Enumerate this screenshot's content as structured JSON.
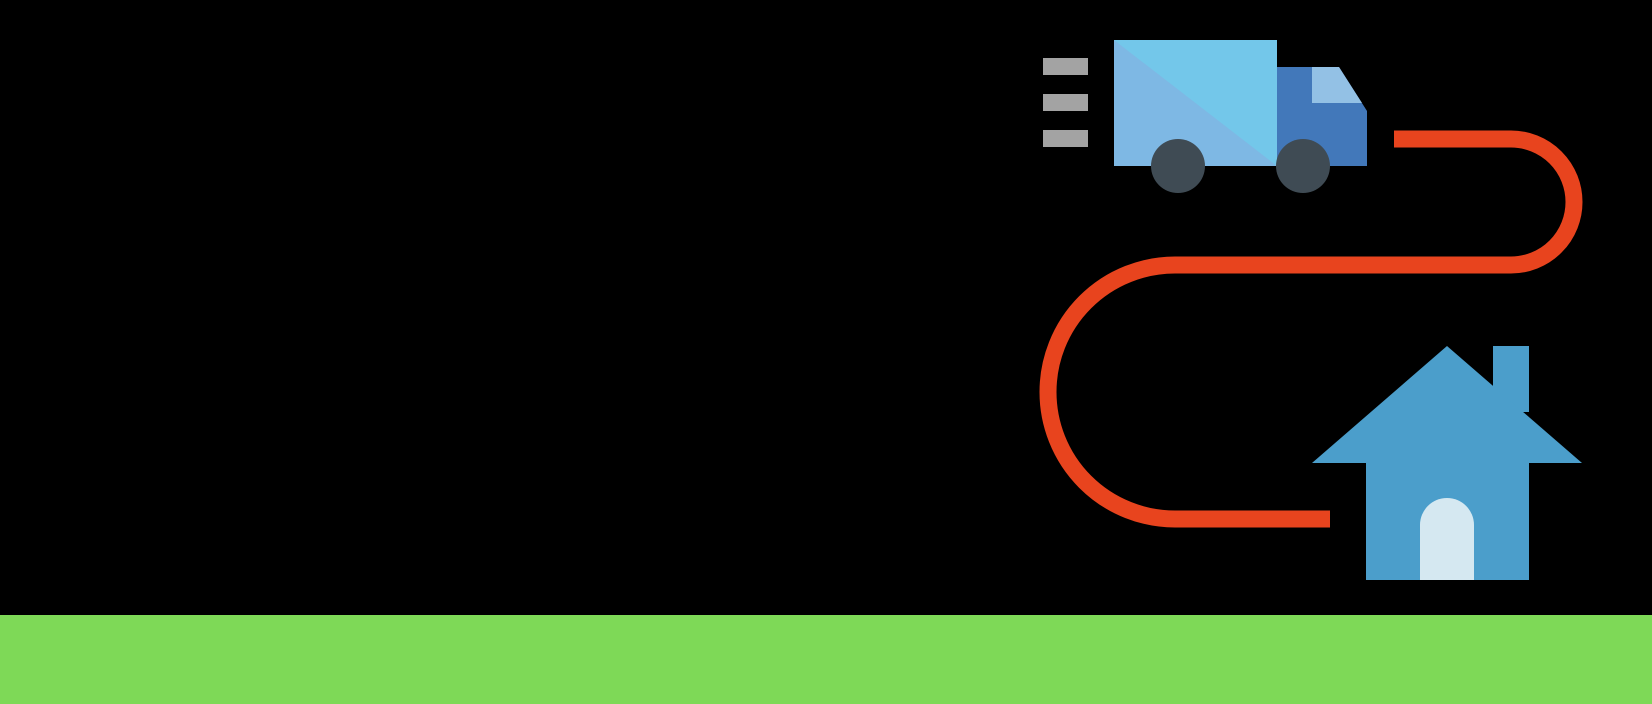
{
  "scene": {
    "description_icons": [
      "delivery-truck-icon",
      "speed-lines-icon",
      "route-path-icon",
      "house-icon"
    ],
    "colors": {
      "background": "#000000",
      "ground": "#7ED957",
      "truck_cargo": "#73C7EA",
      "truck_cargo_shade": "#7EB8E4",
      "truck_cab": "#4278BA",
      "truck_window": "#93C1E5",
      "wheel": "#3F4B54",
      "speed_lines": "#A3A3A3",
      "route": "#E8441E",
      "house": "#4B9ECB",
      "door": "#D5E8F1"
    }
  }
}
